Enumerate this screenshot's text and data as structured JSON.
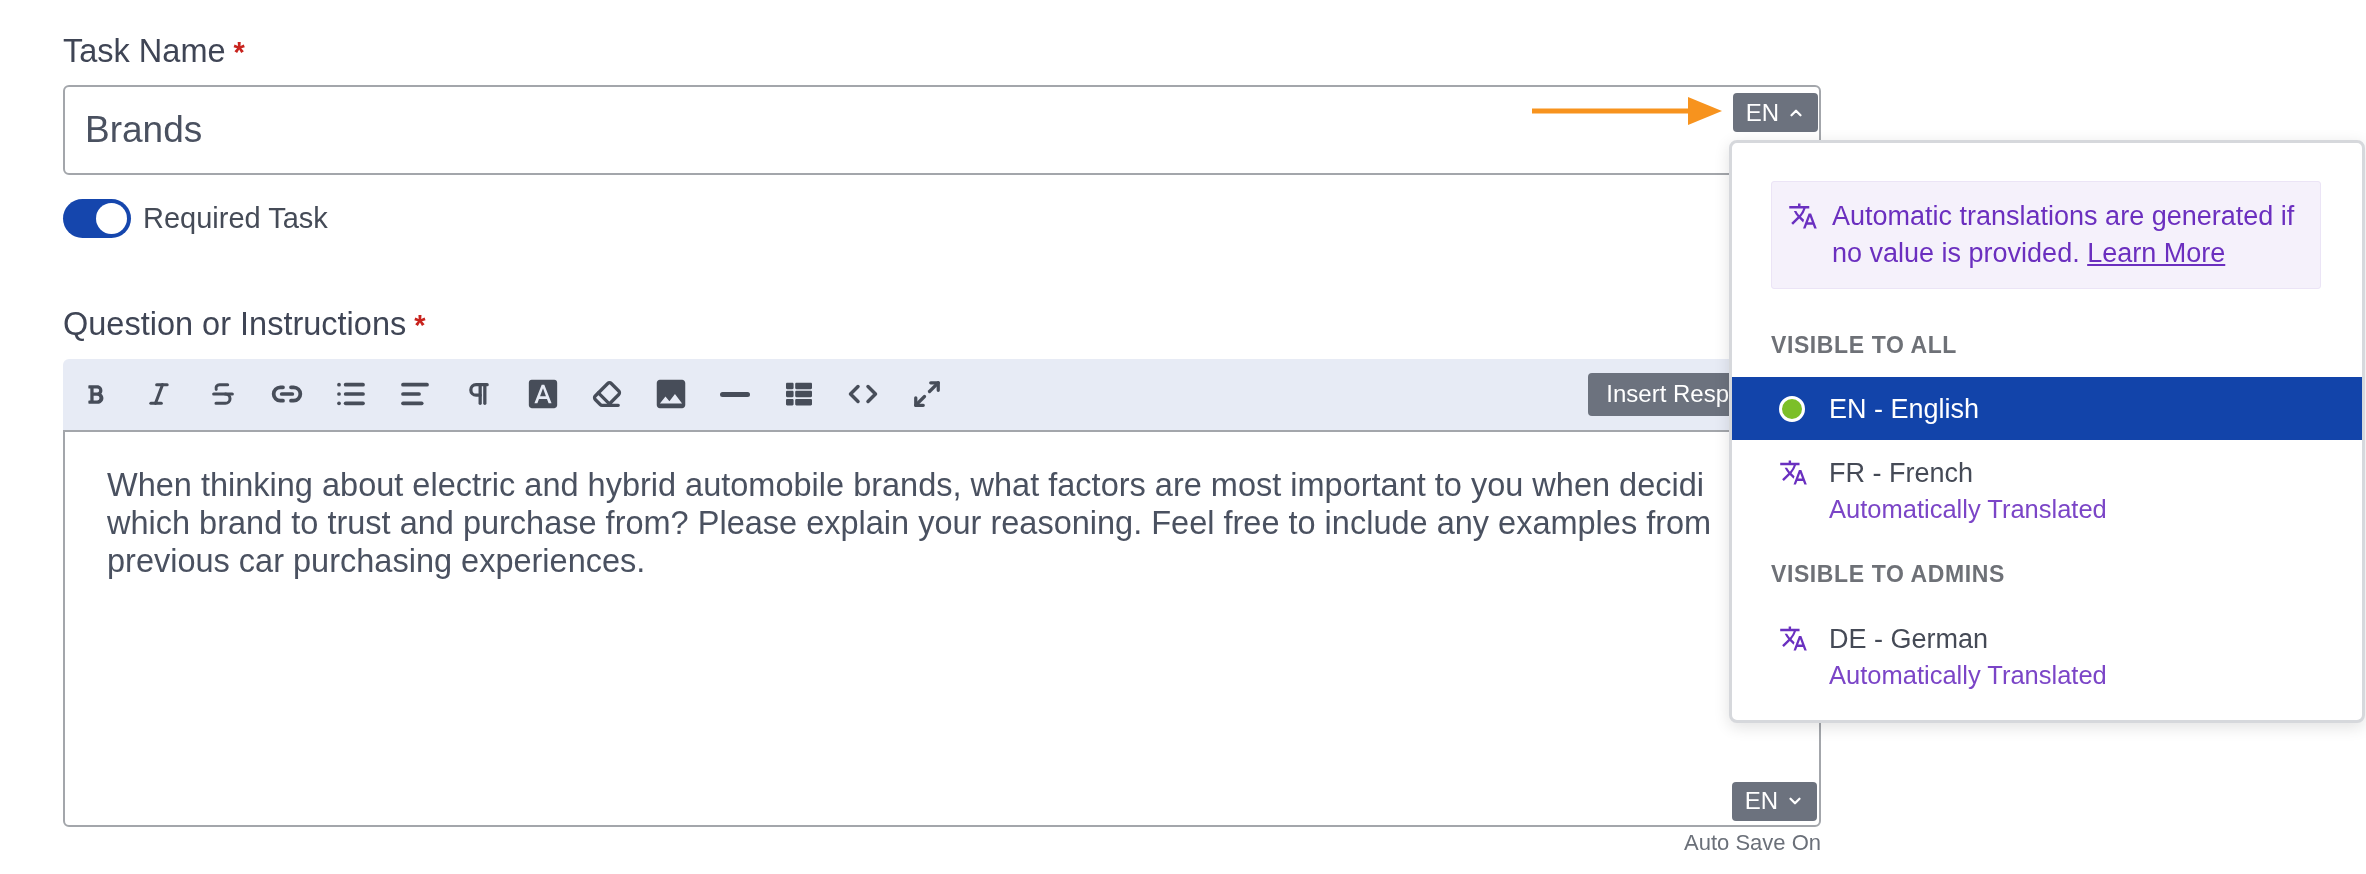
{
  "task_name": {
    "label": "Task Name",
    "required_mark": "*",
    "value": "Brands",
    "language_button": {
      "label": "EN",
      "expanded": true
    }
  },
  "required_task": {
    "label": "Required Task",
    "on": true
  },
  "question": {
    "label": "Question or Instructions",
    "required_mark": "*",
    "toolbar": {
      "insert_button": "Insert Resp"
    },
    "lines": [
      "When thinking about electric and hybrid automobile brands, what factors are most important to you when decidi",
      "which brand to trust and purchase from? Please explain your reasoning. Feel free to include any examples from",
      "previous car purchasing experiences."
    ],
    "language_button": {
      "label": "EN",
      "expanded": false
    }
  },
  "auto_save": "Auto Save On",
  "language_menu": {
    "notice": {
      "text": "Automatic translations are generated if no value is provided.",
      "link": "Learn More"
    },
    "groups": [
      {
        "heading": "VISIBLE TO ALL",
        "items": [
          {
            "kind": "source",
            "label": "EN - English",
            "selected": true
          },
          {
            "kind": "translated",
            "label": "FR - French",
            "status": "Automatically Translated",
            "selected": false
          }
        ]
      },
      {
        "heading": "VISIBLE TO ADMINS",
        "items": [
          {
            "kind": "translated",
            "label": "DE - German",
            "status": "Automatically Translated",
            "selected": false
          }
        ]
      }
    ]
  }
}
